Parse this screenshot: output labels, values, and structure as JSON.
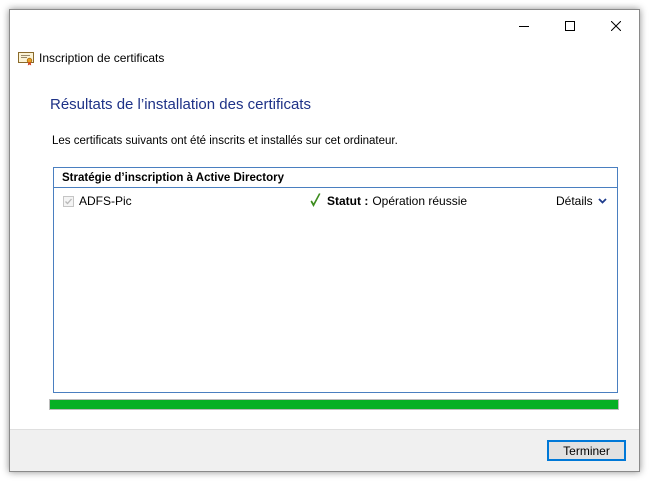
{
  "window": {
    "title": "Inscription de certificats",
    "controls": {
      "minimize": "minimize-icon",
      "maximize": "maximize-icon",
      "close": "close-icon"
    }
  },
  "main": {
    "heading": "Résultats de l’installation des certificats",
    "description": "Les certificats suivants ont été inscrits et installés sur cet ordinateur."
  },
  "policy": {
    "header": "Stratégie d’inscription à Active Directory",
    "items": [
      {
        "name": "ADFS-Pic",
        "checked": true,
        "status_label": "Statut :",
        "status_value": "Opération réussie",
        "details_label": "Détails"
      }
    ]
  },
  "progress": {
    "value_percent": 100
  },
  "footer": {
    "finish_label": "Terminer"
  },
  "colors": {
    "heading": "#1e3287",
    "panel_border": "#4a7fc0",
    "progress_fill": "#06b025",
    "check_mark": "#3c8c1e",
    "button_border": "#0078d7"
  }
}
